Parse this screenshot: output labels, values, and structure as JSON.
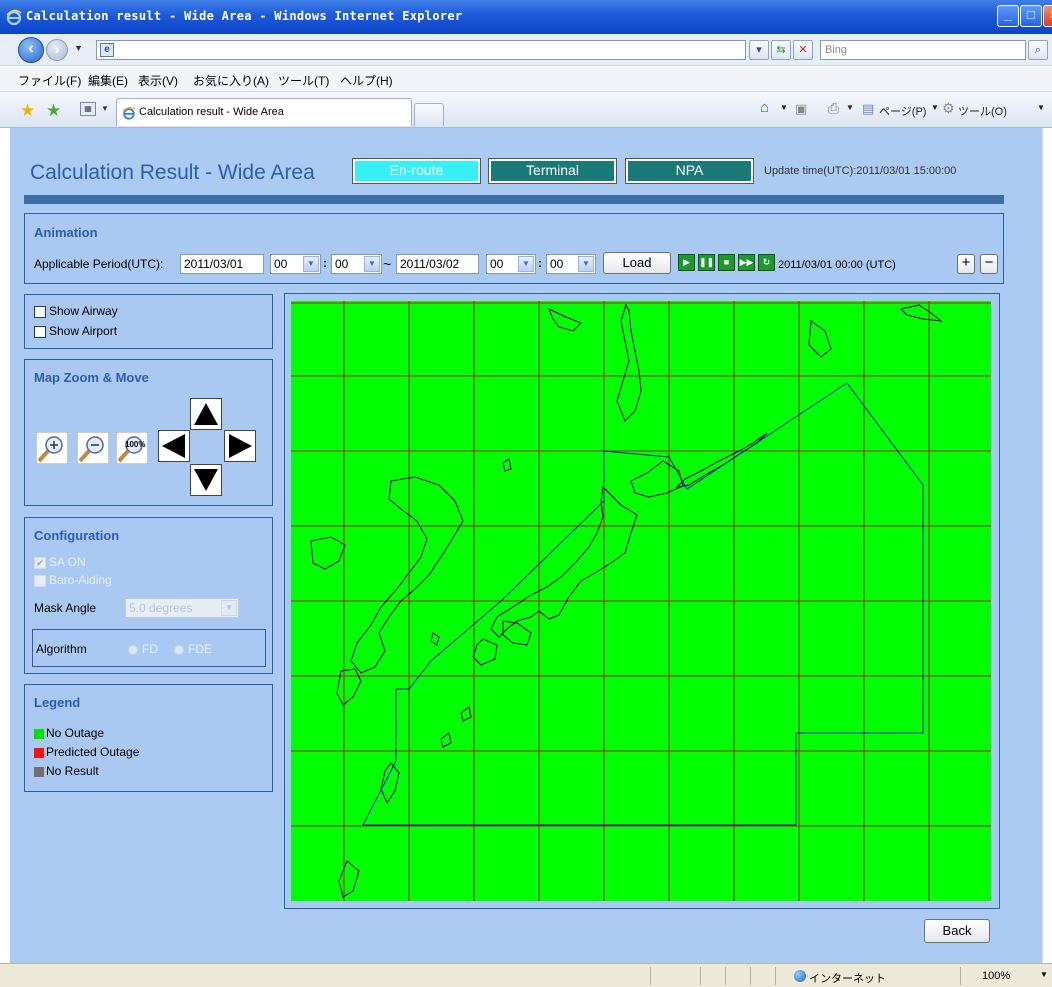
{
  "window": {
    "title": "Calculation result - Wide Area - Windows Internet Explorer"
  },
  "addressbar": {
    "url": "",
    "search_placeholder": "Bing"
  },
  "menu": [
    "ファイル(F)",
    "編集(E)",
    "表示(V)",
    "お気に入り(A)",
    "ツール(T)",
    "ヘルプ(H)"
  ],
  "tab": {
    "label": "Calculation result - Wide Area"
  },
  "commandbar": {
    "page": "ページ(P)",
    "tools": "ツール(O)"
  },
  "page": {
    "title": "Calculation Result - Wide Area",
    "modes": [
      "En-route",
      "Terminal",
      "NPA"
    ],
    "update_time": "Update time(UTC):2011/03/01 15:00:00"
  },
  "animation": {
    "heading": "Animation",
    "period_label": "Applicable Period(UTC):",
    "start_date": "2011/03/01",
    "start_hour": "00",
    "start_min": "00",
    "separator_colon": ":",
    "tilde": "~",
    "end_date": "2011/03/02",
    "end_hour": "00",
    "end_min": "00",
    "load_label": "Load",
    "current_time": "2011/03/01 00:00 (UTC)",
    "plus": "+",
    "minus": "−"
  },
  "display": {
    "show_airway": "Show Airway",
    "show_airport": "Show Airport"
  },
  "zoom": {
    "heading": "Map Zoom & Move",
    "reset_label": "100%"
  },
  "config": {
    "heading": "Configuration",
    "sa_on": "SA ON",
    "baro": "Baro-Aiding",
    "mask_label": "Mask Angle",
    "mask_value": "5.0 degrees",
    "algorithm_label": "Algorithm",
    "fd": "FD",
    "fde": "FDE"
  },
  "legend": {
    "heading": "Legend",
    "items": [
      {
        "label": "No Outage",
        "color": "#00e000"
      },
      {
        "label": "Predicted Outage",
        "color": "#ff1010"
      },
      {
        "label": "No Result",
        "color": "#707070"
      }
    ]
  },
  "map": {
    "background": "#00ff00",
    "grid_color": "#b02020",
    "region_color": "#1a1acc",
    "coast_color": "#000000"
  },
  "back_label": "Back",
  "statusbar": {
    "zone": "インターネット",
    "zoom": "100%"
  }
}
